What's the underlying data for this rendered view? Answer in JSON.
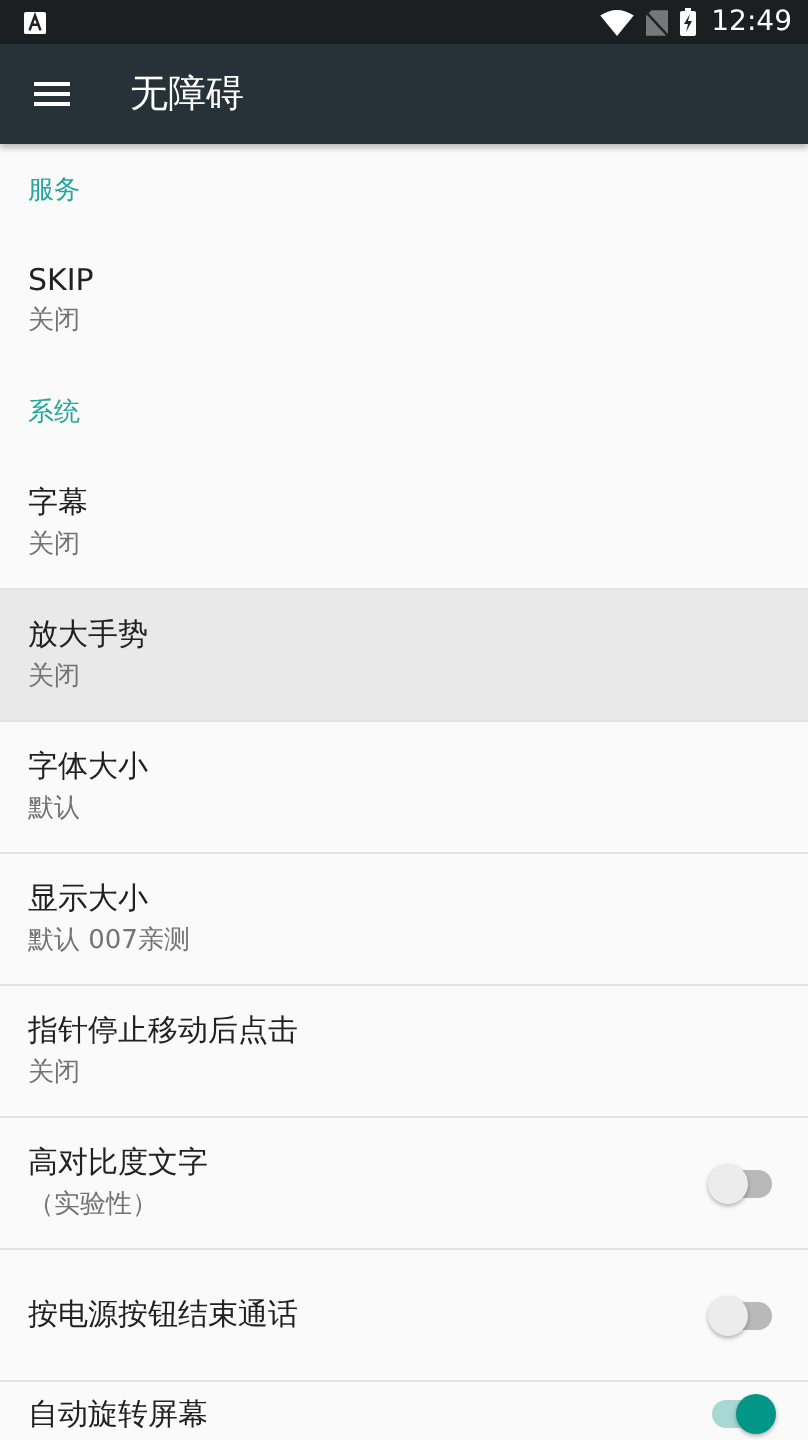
{
  "status_bar": {
    "time": "12:49"
  },
  "toolbar": {
    "title": "无障碍"
  },
  "sections": [
    {
      "header": "服务",
      "items": [
        {
          "kind": "text",
          "title": "SKIP",
          "summary": "关闭",
          "highlighted": false
        }
      ]
    },
    {
      "header": "系统",
      "items": [
        {
          "kind": "text",
          "title": "字幕",
          "summary": "关闭",
          "highlighted": false
        },
        {
          "kind": "text",
          "title": "放大手势",
          "summary": "关闭",
          "highlighted": true
        },
        {
          "kind": "text",
          "title": "字体大小",
          "summary": "默认",
          "highlighted": false
        },
        {
          "kind": "text",
          "title": "显示大小",
          "summary": "默认 007亲测",
          "highlighted": false
        },
        {
          "kind": "text",
          "title": "指针停止移动后点击",
          "summary": "关闭",
          "highlighted": false
        },
        {
          "kind": "switch",
          "title": "高对比度文字",
          "summary": "（实验性）",
          "on": false,
          "highlighted": false
        },
        {
          "kind": "switch",
          "title": "按电源按钮结束通话",
          "on": false,
          "highlighted": false
        },
        {
          "kind": "switch",
          "title": "自动旋转屏幕",
          "on": true,
          "highlighted": false
        }
      ]
    }
  ]
}
